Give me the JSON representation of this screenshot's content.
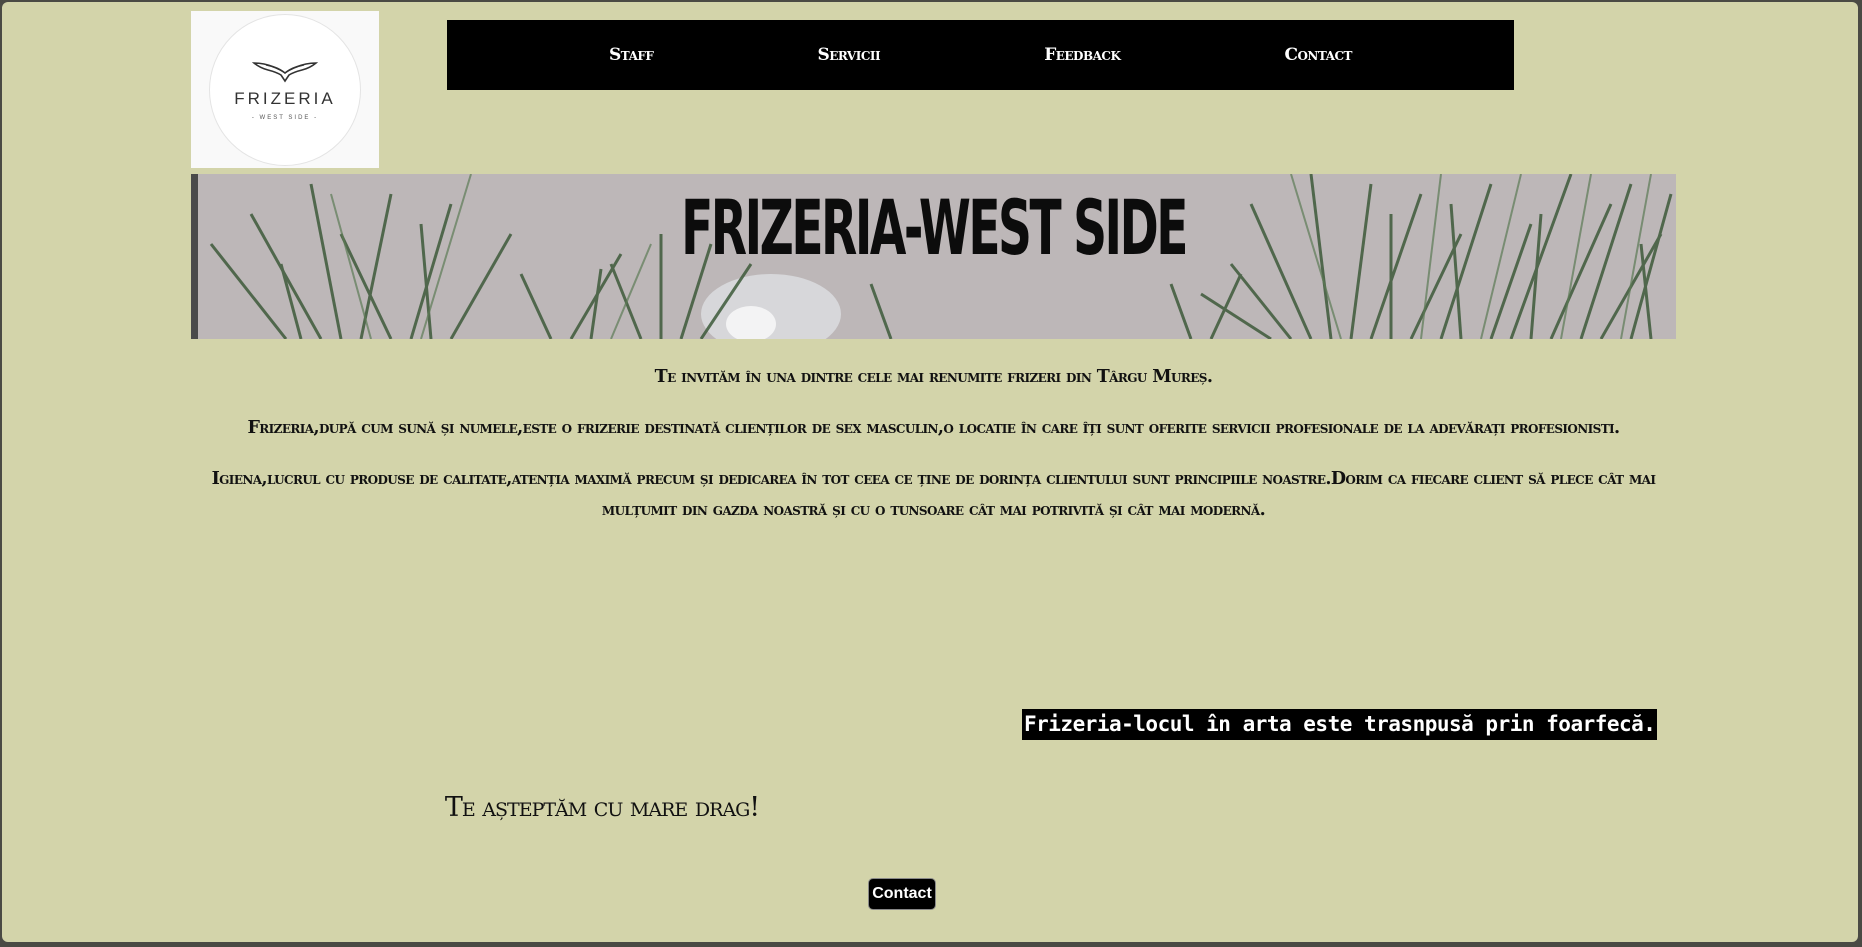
{
  "logo": {
    "name": "FRIZERIA",
    "subtitle": "- WEST SIDE -"
  },
  "nav": {
    "items": [
      {
        "label": "Staff"
      },
      {
        "label": "Servicii"
      },
      {
        "label": "Feedback"
      },
      {
        "label": "Contact"
      }
    ]
  },
  "banner": {
    "title": "FRIZERIA-WEST SIDE"
  },
  "intro": {
    "paragraphs": [
      "Te invităm în una dintre cele mai renumite frizeri din Târgu Mureș.",
      "Frizeria,după cum sună și numele,este o frizerie destinată clienților de sex masculin,o locatie în care îți sunt oferite servicii profesionale de la adevărați profesionisti.",
      "Igiena,lucrul cu produse de calitate,atenția maximă precum și dedicarea în tot ceea ce ține de dorința clientului sunt principiile noastre.Dorim ca fiecare client să plece cât mai mulțumit din gazda noastră și cu o tunsoare cât mai potrivită și cât mai modernă."
    ]
  },
  "motto": "Frizeria-locul în arta este trasnpusă prin foarfecă.",
  "welcome": "Te așteptăm cu mare drag!",
  "contact_button": "Contact",
  "colors": {
    "page_background": "#d3d4aa",
    "nav_background": "#000000",
    "text": "#111111"
  }
}
